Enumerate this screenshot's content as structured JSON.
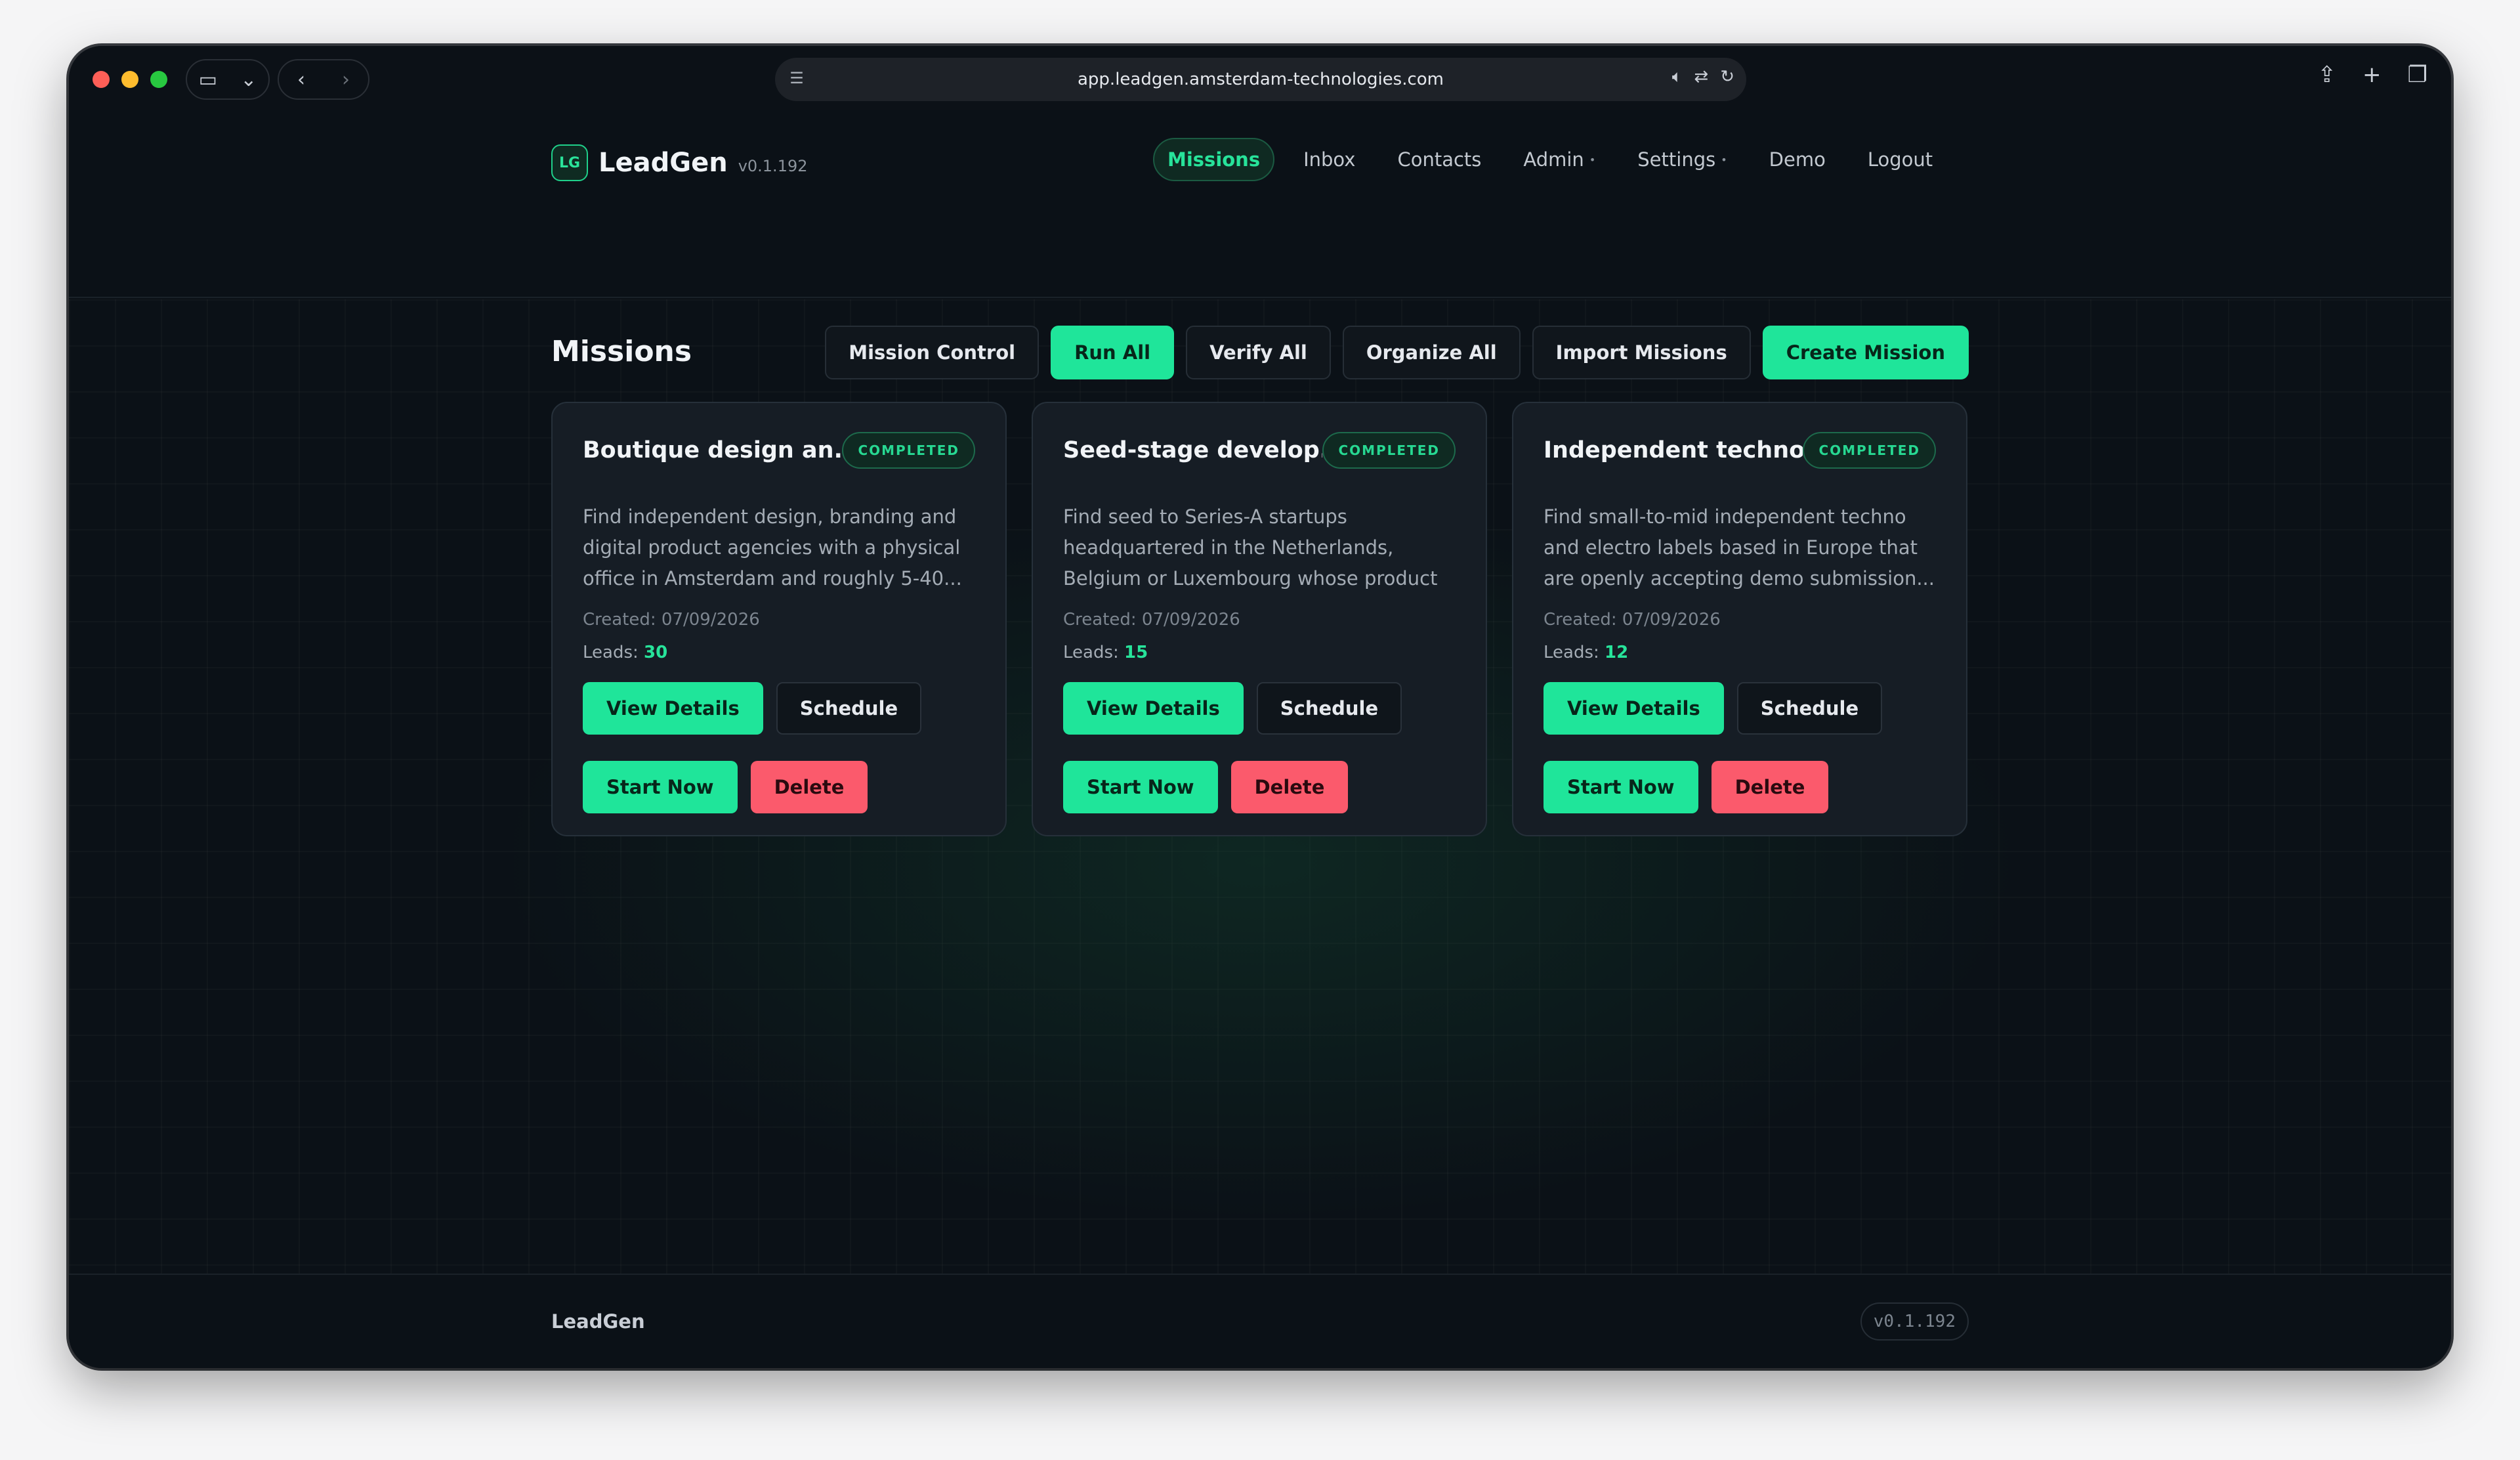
{
  "browser": {
    "url": "app.leadgen.amsterdam-technologies.com"
  },
  "brand": {
    "logo": "LG",
    "name": "LeadGen",
    "version": "v0.1.192"
  },
  "nav": {
    "items": [
      {
        "label": "Missions"
      },
      {
        "label": "Inbox"
      },
      {
        "label": "Contacts"
      },
      {
        "label": "Admin"
      },
      {
        "label": "Settings"
      },
      {
        "label": "Demo"
      },
      {
        "label": "Logout"
      }
    ]
  },
  "page": {
    "title": "Missions",
    "toolbar": {
      "mission_control": "Mission Control",
      "run_all": "Run All",
      "verify_all": "Verify All",
      "organize_all": "Organize All",
      "import_missions": "Import Missions",
      "create_mission": "Create Mission"
    }
  },
  "missions": [
    {
      "title": "Boutique design an...",
      "status": "COMPLETED",
      "description": "Find independent design, branding and digital product agencies with a physical office in Amsterdam and roughly 5-40...",
      "created_label": "Created: 07/09/2026",
      "leads_label": "Leads:",
      "leads": "30",
      "view": "View Details",
      "schedule": "Schedule",
      "start": "Start Now",
      "delete": "Delete"
    },
    {
      "title": "Seed-stage develop...",
      "status": "COMPLETED",
      "description": "Find seed to Series-A startups headquartered in the Netherlands, Belgium or Luxembourg whose product ...",
      "created_label": "Created: 07/09/2026",
      "leads_label": "Leads:",
      "leads": "15",
      "view": "View Details",
      "schedule": "Schedule",
      "start": "Start Now",
      "delete": "Delete"
    },
    {
      "title": "Independent techno...",
      "status": "COMPLETED",
      "description": "Find small-to-mid independent techno and electro labels based in Europe that are openly accepting demo submission...",
      "created_label": "Created: 07/09/2026",
      "leads_label": "Leads:",
      "leads": "12",
      "view": "View Details",
      "schedule": "Schedule",
      "start": "Start Now",
      "delete": "Delete"
    }
  ],
  "footer": {
    "brand": "LeadGen",
    "version": "v0.1.192"
  },
  "colors": {
    "accent": "#1fe59a",
    "danger": "#fb5a6c",
    "background": "#0b1117",
    "card": "#161d25"
  }
}
